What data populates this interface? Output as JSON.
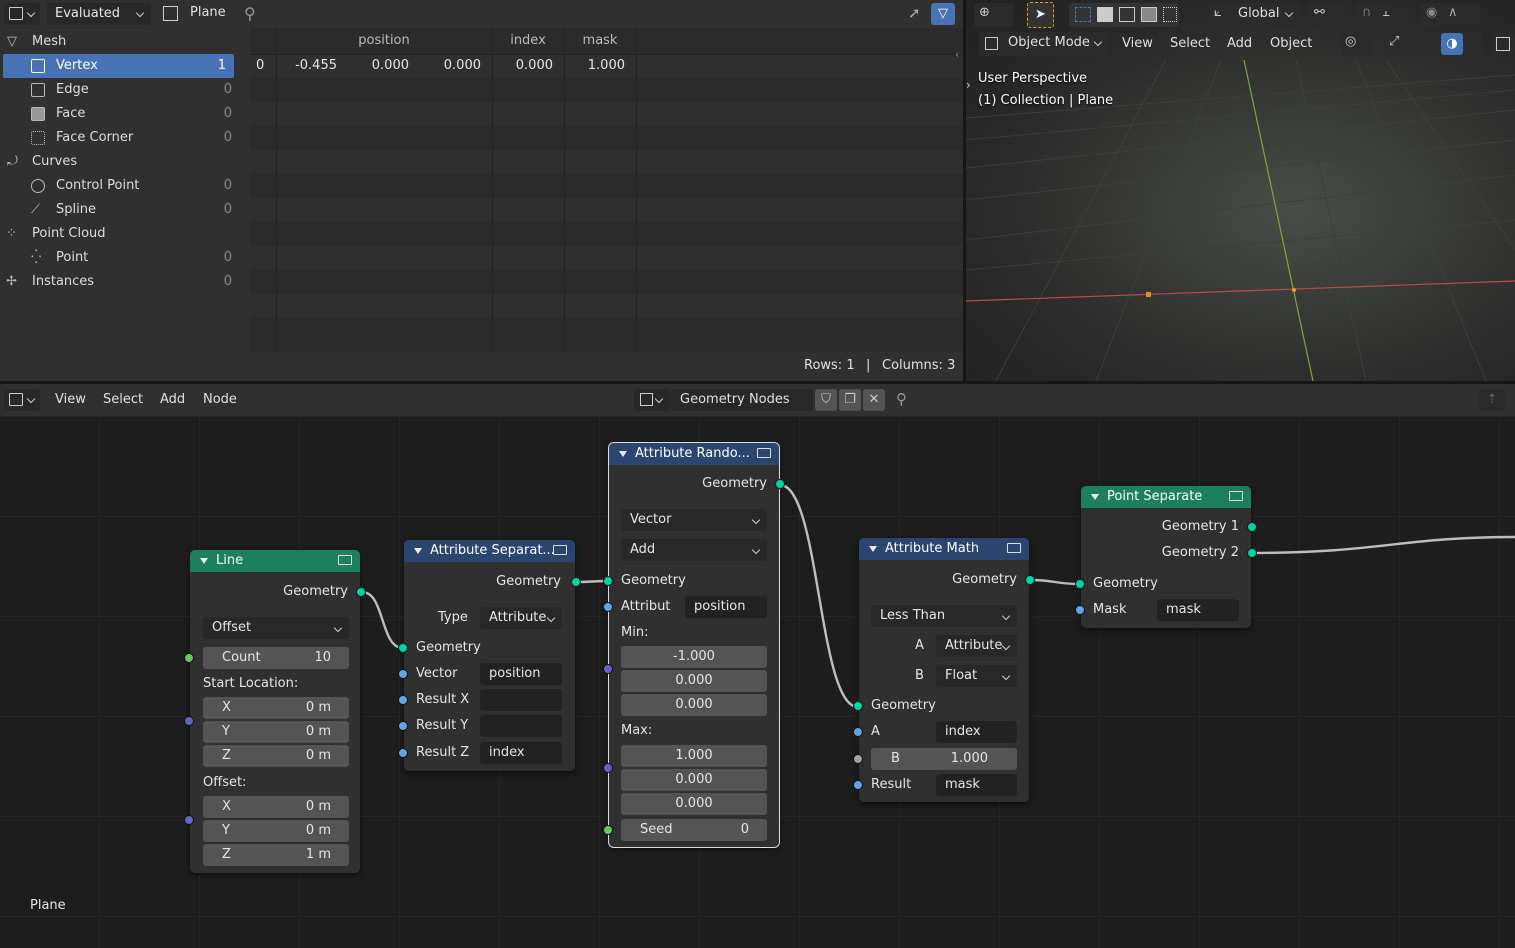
{
  "spreadsheet": {
    "mode": "Evaluated",
    "object": "Plane",
    "tree": [
      {
        "label": "Mesh",
        "count": "",
        "indent": 0,
        "icon": "mesh-icon"
      },
      {
        "label": "Vertex",
        "count": "1",
        "indent": 1,
        "icon": "vertex-icon",
        "selected": true
      },
      {
        "label": "Edge",
        "count": "0",
        "indent": 1,
        "icon": "edge-icon"
      },
      {
        "label": "Face",
        "count": "0",
        "indent": 1,
        "icon": "face-icon"
      },
      {
        "label": "Face Corner",
        "count": "0",
        "indent": 1,
        "icon": "face-corner-icon"
      },
      {
        "label": "Curves",
        "count": "",
        "indent": 0,
        "icon": "curves-icon"
      },
      {
        "label": "Control Point",
        "count": "0",
        "indent": 1,
        "icon": "control-point-icon"
      },
      {
        "label": "Spline",
        "count": "0",
        "indent": 1,
        "icon": "spline-icon"
      },
      {
        "label": "Point Cloud",
        "count": "",
        "indent": 0,
        "icon": "point-cloud-icon"
      },
      {
        "label": "Point",
        "count": "0",
        "indent": 1,
        "icon": "point-icon"
      },
      {
        "label": "Instances",
        "count": "0",
        "indent": 0,
        "icon": "instances-icon"
      }
    ],
    "columns": {
      "position": "position",
      "index": "index",
      "mask": "mask"
    },
    "row": {
      "idx": "0",
      "px": "-0.455",
      "py": "0.000",
      "pz": "0.000",
      "index": "0.000",
      "mask": "1.000"
    },
    "footer": {
      "rows": "Rows: 1",
      "sep": "|",
      "columns": "Columns: 3"
    }
  },
  "viewport": {
    "mode": "Object Mode",
    "menu": [
      "View",
      "Select",
      "Add",
      "Object"
    ],
    "orientation": "Global",
    "overlay_title": "User Perspective",
    "overlay_sub": "(1) Collection | Plane"
  },
  "node_editor": {
    "menu": [
      "View",
      "Select",
      "Add",
      "Node"
    ],
    "tree_name": "Geometry Nodes",
    "footer_label": "Plane",
    "nodes": {
      "line": {
        "title": "Line",
        "out_geometry": "Geometry",
        "mode": "Offset",
        "count_label": "Count",
        "count_value": "10",
        "start_label": "Start Location:",
        "offset_label": "Offset:",
        "sx": "0 m",
        "sy": "0 m",
        "sz": "0 m",
        "ox": "0 m",
        "oy": "0 m",
        "oz": "1 m",
        "x": "X",
        "y": "Y",
        "z": "Z"
      },
      "separate": {
        "title": "Attribute Separat...",
        "out_geometry": "Geometry",
        "type_label": "Type",
        "type_value": "Attribute",
        "in_geometry": "Geometry",
        "vector_label": "Vector",
        "vector_value": "position",
        "rx": "Result X",
        "ry": "Result Y",
        "rz": "Result Z",
        "rz_value": "index"
      },
      "randomize": {
        "title": "Attribute Rando...",
        "out_geometry": "Geometry",
        "type": "Vector",
        "op": "Add",
        "in_geometry": "Geometry",
        "attr_label": "Attribut",
        "attr_value": "position",
        "min_label": "Min:",
        "min": [
          "-1.000",
          "0.000",
          "0.000"
        ],
        "max_label": "Max:",
        "max": [
          "1.000",
          "0.000",
          "0.000"
        ],
        "seed_label": "Seed",
        "seed_value": "0"
      },
      "math": {
        "title": "Attribute Math",
        "out_geometry": "Geometry",
        "op": "Less Than",
        "a_label": "A",
        "a_type": "Attribute",
        "b_label": "B",
        "b_type": "Float",
        "in_geometry": "Geometry",
        "a_value": "index",
        "b_value": "1.000",
        "result_label": "Result",
        "result_value": "mask"
      },
      "separate_pts": {
        "title": "Point Separate",
        "out1": "Geometry 1",
        "out2": "Geometry 2",
        "in_geometry": "Geometry",
        "mask_label": "Mask",
        "mask_value": "mask"
      }
    }
  },
  "colors": {
    "geometry_socket": "#00d6a3",
    "vector_socket": "#6363c7",
    "attribute_socket": "#63a3e6",
    "geometry_header": "#1d7a5c",
    "attribute_header": "#29457a",
    "selection": "#4772b3"
  }
}
